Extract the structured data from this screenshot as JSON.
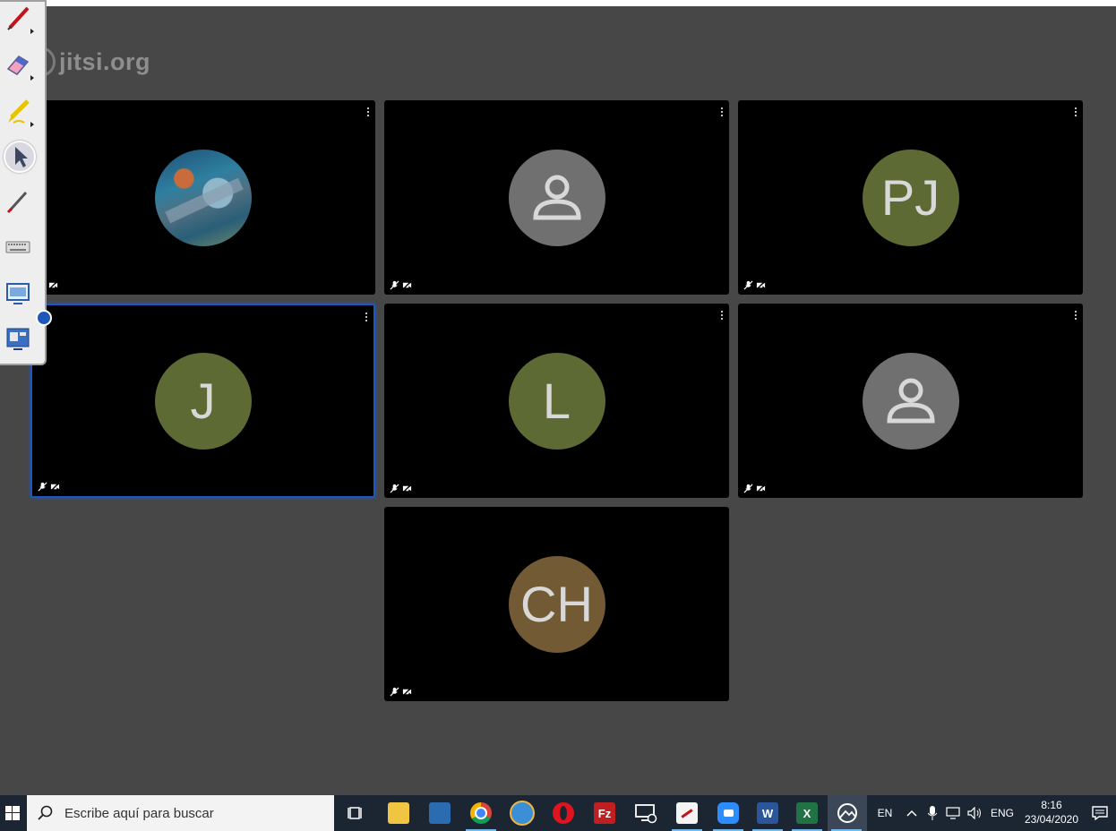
{
  "window": {
    "logo_text": "jitsi.org"
  },
  "participants": [
    {
      "id": "p1",
      "initials": "",
      "avatar_type": "photo",
      "avatar_color": "#2e7fa0",
      "audio_muted": true,
      "video_muted": true,
      "active": false
    },
    {
      "id": "p2",
      "initials": "",
      "avatar_type": "default-user",
      "avatar_color": "#707070",
      "audio_muted": true,
      "video_muted": true,
      "active": false
    },
    {
      "id": "p3",
      "initials": "PJ",
      "avatar_type": "initials",
      "avatar_color": "#5e6a33",
      "audio_muted": true,
      "video_muted": true,
      "active": false
    },
    {
      "id": "p4",
      "initials": "J",
      "avatar_type": "initials",
      "avatar_color": "#5e6a33",
      "audio_muted": true,
      "video_muted": true,
      "active": true
    },
    {
      "id": "p5",
      "initials": "L",
      "avatar_type": "initials",
      "avatar_color": "#5e6a33",
      "audio_muted": true,
      "video_muted": true,
      "active": false
    },
    {
      "id": "p6",
      "initials": "",
      "avatar_type": "default-user",
      "avatar_color": "#707070",
      "audio_muted": true,
      "video_muted": true,
      "active": false
    },
    {
      "id": "p7",
      "initials": "CH",
      "avatar_type": "initials",
      "avatar_color": "#725b34",
      "audio_muted": true,
      "video_muted": true,
      "active": false
    }
  ],
  "annotation_toolbar": {
    "tools": [
      "pen-icon",
      "eraser-icon",
      "highlighter-icon",
      "pointer-icon",
      "laser-pen-icon",
      "keyboard-icon",
      "screen-capture-icon",
      "display-switch-icon"
    ]
  },
  "taskbar": {
    "search_placeholder": "Escribe aquí para buscar",
    "apps": [
      "task-view-icon",
      "file-explorer-icon",
      "store-icon",
      "chrome-icon",
      "browser-icon",
      "opera-icon",
      "filezilla-icon",
      "remote-desktop-icon",
      "whiteboard-icon",
      "zoom-icon",
      "word-icon",
      "excel-icon",
      "photos-icon"
    ],
    "language_short": "EN",
    "language": "ENG",
    "time": "8:16",
    "date": "23/04/2020",
    "colors": {
      "taskbar_bg": "#1c2633",
      "accent": "#76b9ed",
      "active_border": "#1f57b8"
    }
  }
}
